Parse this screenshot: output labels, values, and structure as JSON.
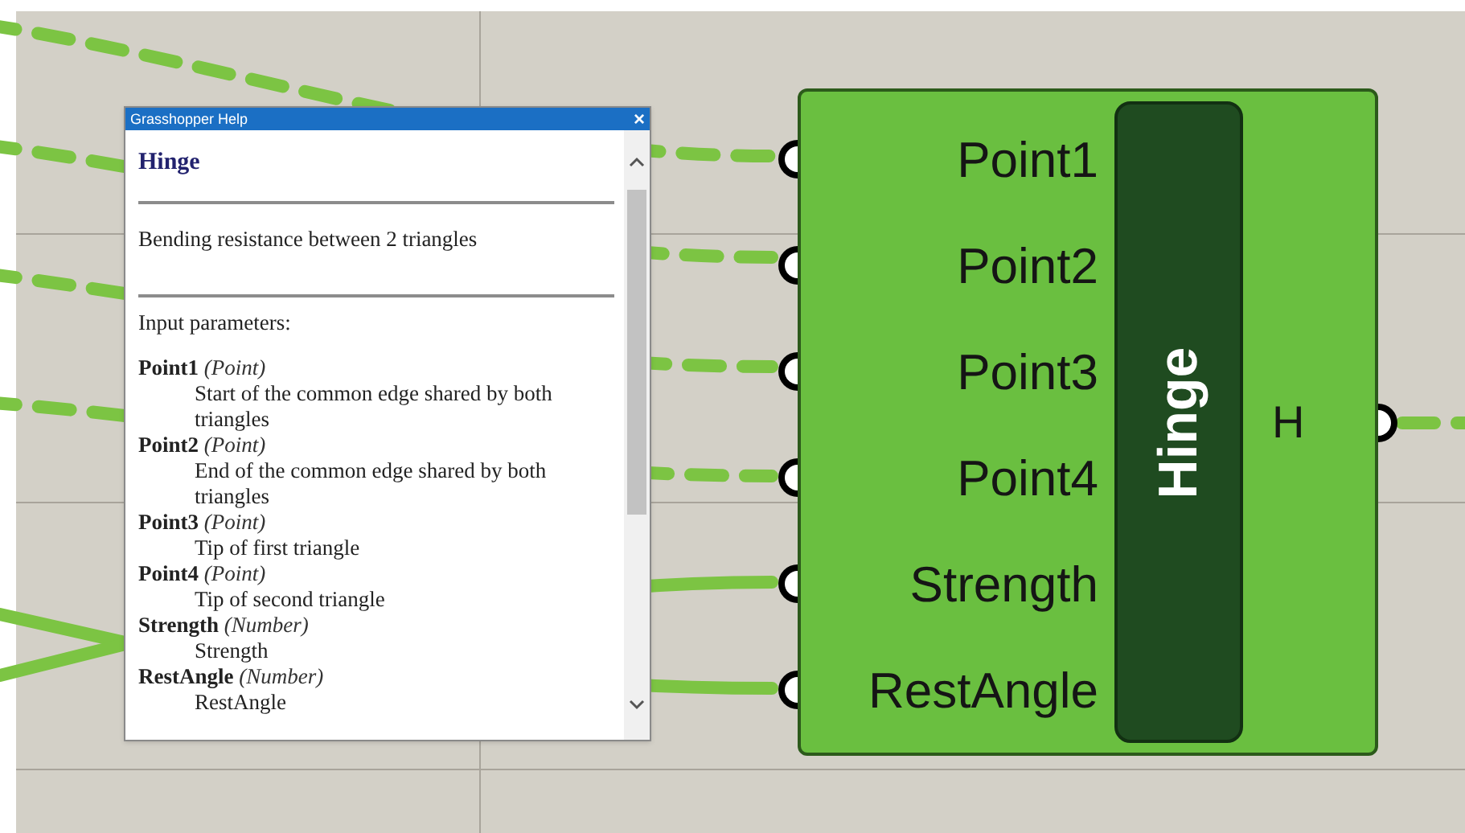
{
  "help_window": {
    "title": "Grasshopper Help",
    "close": "×",
    "heading": "Hinge",
    "description": "Bending resistance between 2 triangles",
    "section_label": "Input parameters:",
    "parameters": [
      {
        "name": "Point1",
        "type": "(Point)",
        "description": "Start of the common edge shared by both triangles"
      },
      {
        "name": "Point2",
        "type": "(Point)",
        "description": "End of the common edge shared by both triangles"
      },
      {
        "name": "Point3",
        "type": "(Point)",
        "description": "Tip of first triangle"
      },
      {
        "name": "Point4",
        "type": "(Point)",
        "description": "Tip of second triangle"
      },
      {
        "name": "Strength",
        "type": "(Number)",
        "description": "Strength"
      },
      {
        "name": "RestAngle",
        "type": "(Number)",
        "description": "RestAngle"
      }
    ]
  },
  "component": {
    "name": "Hinge",
    "inputs": [
      {
        "label": "Point1",
        "kind": "dashed"
      },
      {
        "label": "Point2",
        "kind": "dashed"
      },
      {
        "label": "Point3",
        "kind": "dashed"
      },
      {
        "label": "Point4",
        "kind": "dashed"
      },
      {
        "label": "Strength",
        "kind": "solid"
      },
      {
        "label": "RestAngle",
        "kind": "solid"
      }
    ],
    "outputs": [
      {
        "label": "H",
        "kind": "dashed"
      }
    ]
  }
}
